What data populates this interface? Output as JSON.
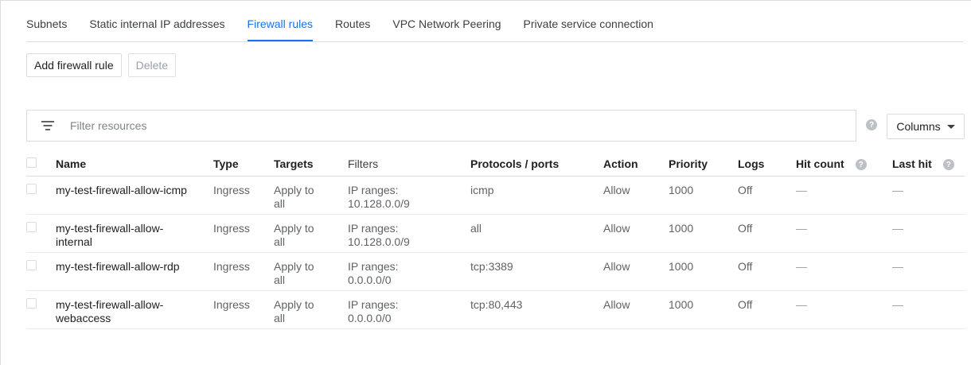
{
  "tabs": [
    {
      "label": "Subnets"
    },
    {
      "label": "Static internal IP addresses"
    },
    {
      "label": "Firewall rules"
    },
    {
      "label": "Routes"
    },
    {
      "label": "VPC Network Peering"
    },
    {
      "label": "Private service connection"
    }
  ],
  "active_tab": "Firewall rules",
  "toolbar": {
    "add_label": "Add firewall rule",
    "delete_label": "Delete"
  },
  "filter": {
    "placeholder": "Filter resources"
  },
  "columns_label": "Columns",
  "help_glyph": "?",
  "table": {
    "headers": {
      "name": "Name",
      "type": "Type",
      "targets": "Targets",
      "filters": "Filters",
      "protocols": "Protocols / ports",
      "action": "Action",
      "priority": "Priority",
      "logs": "Logs",
      "hit_count": "Hit count",
      "last_hit": "Last hit"
    },
    "rows": [
      {
        "name": "my-test-firewall-allow-icmp",
        "type": "Ingress",
        "targets": "Apply to all",
        "filters": "IP ranges: 10.128.0.0/9",
        "protocols": "icmp",
        "action": "Allow",
        "priority": "1000",
        "logs": "Off",
        "hit_count": "—",
        "last_hit": "—"
      },
      {
        "name": "my-test-firewall-allow-internal",
        "type": "Ingress",
        "targets": "Apply to all",
        "filters": "IP ranges: 10.128.0.0/9",
        "protocols": "all",
        "action": "Allow",
        "priority": "1000",
        "logs": "Off",
        "hit_count": "—",
        "last_hit": "—"
      },
      {
        "name": "my-test-firewall-allow-rdp",
        "type": "Ingress",
        "targets": "Apply to all",
        "filters": "IP ranges: 0.0.0.0/0",
        "protocols": "tcp:3389",
        "action": "Allow",
        "priority": "1000",
        "logs": "Off",
        "hit_count": "—",
        "last_hit": "—"
      },
      {
        "name": "my-test-firewall-allow-webaccess",
        "type": "Ingress",
        "targets": "Apply to all",
        "filters": "IP ranges: 0.0.0.0/0",
        "protocols": "tcp:80,443",
        "action": "Allow",
        "priority": "1000",
        "logs": "Off",
        "hit_count": "—",
        "last_hit": "—"
      }
    ]
  },
  "colors": {
    "accent": "#1a73e8",
    "border": "#dadce0",
    "text": "#3c4043"
  }
}
